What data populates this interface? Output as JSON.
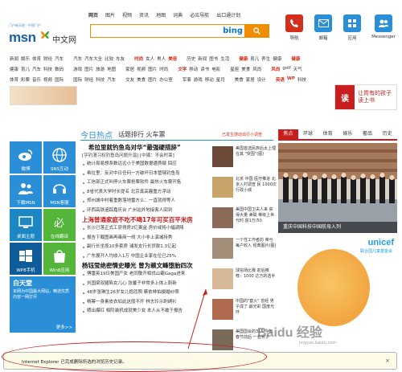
{
  "topnav": [
    "网页",
    "图片",
    "视频",
    "资讯",
    "地图",
    "词典",
    "必应导航",
    "出口通计划"
  ],
  "logo": {
    "tagline": "门户新天地 · 中国门户",
    "brand": "msn",
    "cn": "中文网"
  },
  "search": {
    "engine": "bing"
  },
  "top_icons": [
    {
      "label": "导航",
      "color": "#d42e1c",
      "icon": "phone-icon"
    },
    {
      "label": "邮箱",
      "color": "#2a8fd6",
      "icon": "mail-icon"
    },
    {
      "label": "应用",
      "color": "#2a8fd6",
      "icon": "grid-icon"
    },
    {
      "label": "Messenger",
      "color": "#2a8fd6",
      "icon": "messenger-icon"
    }
  ],
  "categories": [
    [
      [
        "新闻",
        "娱乐",
        "体育",
        "财经",
        "汽车"
      ],
      [
        "汽车",
        "汽车大全",
        "比较",
        "车友"
      ],
      [
        "时尚",
        "女人",
        "男人",
        "美容"
      ],
      [
        "历史",
        "新闻",
        "图书",
        "生活"
      ],
      [
        "健康",
        "育儿",
        "养生",
        "健康"
      ],
      [
        "健康"
      ]
    ],
    [
      [
        "健康",
        "育儿",
        "汽车",
        "科技",
        "数码"
      ],
      [
        "游戏",
        "图片",
        "旅游",
        "地图"
      ],
      [
        "家居",
        "视频",
        "图片",
        "时尚"
      ],
      [
        "文学",
        "移动",
        "读书",
        "电影"
      ],
      [
        "星座",
        "美食",
        "风尚"
      ],
      [
        "风尚",
        "golf",
        "天气"
      ]
    ],
    [
      [
        "体育",
        "彩票",
        "音乐",
        "视频",
        "国际"
      ],
      [
        "国际",
        "财经",
        "科技",
        "汽车"
      ],
      [
        "交友",
        "美食",
        "图片",
        "办公室"
      ],
      [
        "军事",
        "游戏",
        "移动",
        "星月"
      ],
      [
        "美食",
        "家居",
        "设计"
      ],
      [
        "英语",
        "WP",
        "科技"
      ]
    ]
  ],
  "banner_right": {
    "badge": "读",
    "text1": "让胃有的孩子",
    "text2": "读上书"
  },
  "tiles": [
    {
      "label": "微博"
    },
    {
      "label": "SNS互动"
    },
    {
      "label": "下载MSN"
    },
    {
      "label": "MSN客服"
    },
    {
      "label": "桌面主题"
    },
    {
      "label": "在线翻译"
    },
    {
      "label": "WP8手机"
    },
    {
      "label": "Win8应用"
    }
  ],
  "sky": {
    "title": "白天堂",
    "desc": "本网为中国最大网站，精选优质内容一网打尽",
    "more": "更多>>"
  },
  "hot": {
    "title": "今日热点",
    "sub": "话题排行 火车票",
    "right": "已发生感动出行小调查"
  },
  "news": {
    "h1": "希拉里就钓鱼岛对华“最强硬措辞”",
    "h1_sub": "[亨钓漫习权钓鱼岛问题升温] [中媒：不会时束]",
    "items1": [
      "统计局易想系数远远小于美国数据遭质疑 回应",
      "希拉里：反对中日任何一方破坏日本管辖钓鱼岛",
      "工信部正式叫停火车票抢票软件 最热火车票开售",
      "8省代表大学时长提名 北京真高霾重方浮动",
      "郑州城中村着重数落地雷方么：一直就得等人",
      "环西高铁追踪嘉庆台 广州站外地接客人回到"
    ],
    "h2": "上海普通家庭不吃不喝17年可买百平米房",
    "items2": [
      "长沙已落正式工获得房2亿案盒 房价或将小幅调降",
      "报告下载图画再毒商一线 大小非上演减持秀",
      "副行长坐揽10多套房 浦发支行长贷款1.3亿起",
      "广东展开人均收入1万 中国企业家在位已25%"
    ],
    "h3": "杨钰莹绝密情史曝光 曾为赖文峰堕胎四次",
    "items3": [
      "傅雷英19日美国产女 老同敬开相伐山霸Gaga进来",
      "刘国梁双腿陷女儿心 张馨子非常多上体上刺新",
      "48岁张琳生26岁女儿抱怨照 蔡依林拍摄婚纱照",
      "杨幂一身素皮衣如此这般不开 林志玲示刺绣衫",
      "晒出爆红 相阶装机成就美少女 本人从不敢于报告"
    ]
  },
  "thumbs": [
    {
      "cap": "美国首选民族后太上理在其 \"突围\"(图)",
      "color": "#6b4a3a"
    },
    {
      "cap": "北京 中国 医疗推进 北京入村调查 民 1000次 行政小城",
      "color": "#c8a46a"
    },
    {
      "cap": "美国中国卫夫人来 获得大量 美联 等级上世代时 获1万/50",
      "color": "#8b6a5a"
    },
    {
      "cap": "一个性工作者的 荣与每户收入 经典图片(图)",
      "color": "#a38e7a"
    },
    {
      "cap": "球拍场比赛 前后推荐：1000 达万的选手",
      "color": "#d7b99a"
    },
    {
      "cap": "中国的\"套火\" 曾经 男子成了 最光彩 国度光环",
      "color": "#b06a50"
    },
    {
      "cap": "美国国会的315 今年春节前后 一名男子",
      "color": "#7a6a5a"
    }
  ],
  "tabs": [
    "焦点",
    "环球",
    "体育",
    "娱乐",
    "奢品",
    "历史"
  ],
  "photo": {
    "caption": "重庆中国科技中国航母入列"
  },
  "unicef": {
    "name": "unicef",
    "sub": "联合国儿童基金会"
  },
  "watermark": {
    "main": "Baidu 经验",
    "sub": "jingyan.baidu.com"
  },
  "notice": {
    "message": "Internet Explorer 已完成删除所选的浏览历史记录。",
    "close": "×"
  }
}
